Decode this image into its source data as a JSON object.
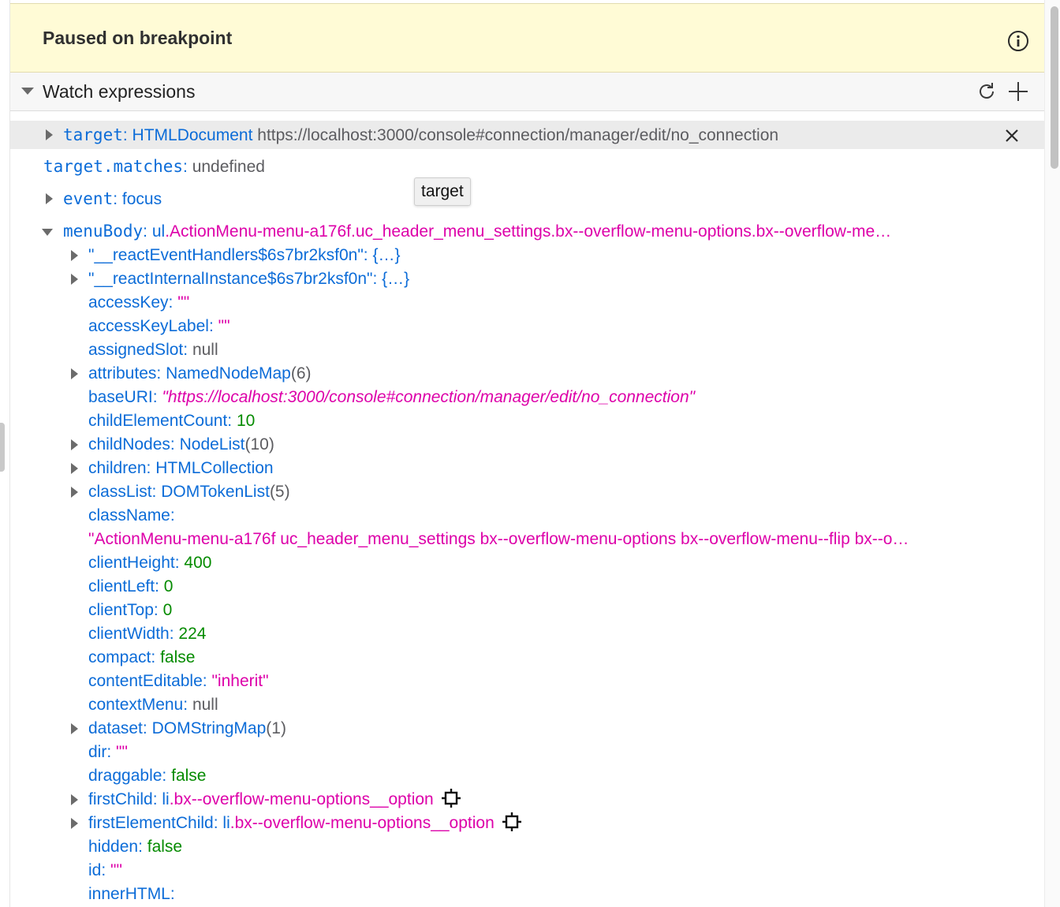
{
  "pause_banner": {
    "title": "Paused on breakpoint",
    "icon": "info-icon"
  },
  "watch": {
    "title": "Watch expressions",
    "refresh_icon": "refresh-icon",
    "add_icon": "add-icon",
    "expressions": [
      {
        "name": "target",
        "type": "HTMLDocument",
        "value": "https://localhost:3000/console#connection/manager/edit/no_connection"
      },
      {
        "name": "target.matches",
        "value": "undefined"
      },
      {
        "name": "event",
        "value": "focus"
      },
      {
        "name": "menuBody",
        "prefix": "ul",
        "value": ".ActionMenu-menu-a176f.uc_header_menu_settings.bx--overflow-menu-options.bx--overflow-me…"
      }
    ],
    "tooltip": "target"
  },
  "properties": [
    {
      "key": "\"__reactEventHandlers$6s7br2ksf0n\"",
      "value": "{…}"
    },
    {
      "key": "\"__reactInternalInstance$6s7br2ksf0n\"",
      "value": "{…}"
    },
    {
      "key": "accessKey",
      "value": "\"\""
    },
    {
      "key": "accessKeyLabel",
      "value": "\"\""
    },
    {
      "key": "assignedSlot",
      "value": "null"
    },
    {
      "key": "attributes",
      "value": "NamedNodeMap",
      "extra": "(6)"
    },
    {
      "key": "baseURI",
      "value": "\"https://localhost:3000/console#connection/manager/edit/no_connection\""
    },
    {
      "key": "childElementCount",
      "value": "10"
    },
    {
      "key": "childNodes",
      "value": "NodeList",
      "extra": "(10)"
    },
    {
      "key": "children",
      "value": "HTMLCollection"
    },
    {
      "key": "classList",
      "value": "DOMTokenList",
      "extra": "(5)"
    },
    {
      "key": "className",
      "value": ""
    },
    {
      "key": "",
      "value": "\"ActionMenu-menu-a176f uc_header_menu_settings bx--overflow-menu-options bx--overflow-menu--flip bx--o…"
    },
    {
      "key": "clientHeight",
      "value": "400"
    },
    {
      "key": "clientLeft",
      "value": "0"
    },
    {
      "key": "clientTop",
      "value": "0"
    },
    {
      "key": "clientWidth",
      "value": "224"
    },
    {
      "key": "compact",
      "value": "false"
    },
    {
      "key": "contentEditable",
      "value": "\"inherit\""
    },
    {
      "key": "contextMenu",
      "value": "null"
    },
    {
      "key": "dataset",
      "value": "DOMStringMap",
      "extra": "(1)"
    },
    {
      "key": "dir",
      "value": "\"\""
    },
    {
      "key": "draggable",
      "value": "false"
    },
    {
      "key": "firstChild",
      "prefix": "li",
      "value": ".bx--overflow-menu-options__option"
    },
    {
      "key": "firstElementChild",
      "prefix": "li",
      "value": ".bx--overflow-menu-options__option"
    },
    {
      "key": "hidden",
      "value": "false"
    },
    {
      "key": "id",
      "value": "\"\""
    },
    {
      "key": "innerHTML",
      "value": ""
    }
  ],
  "sep": ":",
  "colors": {
    "banner_bg": "#fffbd6",
    "key_blue": "#0c6cd8",
    "string_pink": "#dd00a9",
    "number_green": "#058b00"
  }
}
